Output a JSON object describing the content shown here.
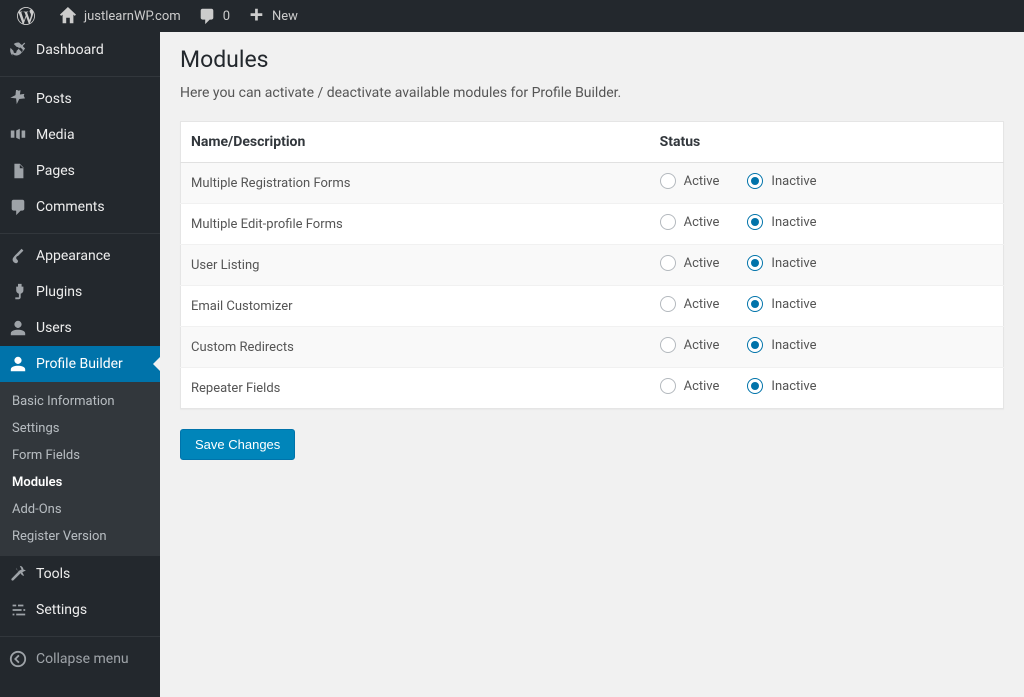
{
  "toolbar": {
    "site_name": "justlearnWP.com",
    "comments_count": "0",
    "new_label": "New"
  },
  "sidebar": {
    "items": [
      {
        "label": "Dashboard",
        "icon": "dashboard"
      },
      {
        "label": "Posts",
        "icon": "pin"
      },
      {
        "label": "Media",
        "icon": "media"
      },
      {
        "label": "Pages",
        "icon": "page"
      },
      {
        "label": "Comments",
        "icon": "comment"
      },
      {
        "label": "Appearance",
        "icon": "brush"
      },
      {
        "label": "Plugins",
        "icon": "plugin"
      },
      {
        "label": "Users",
        "icon": "user"
      },
      {
        "label": "Profile Builder",
        "icon": "profile"
      },
      {
        "label": "Tools",
        "icon": "wrench"
      },
      {
        "label": "Settings",
        "icon": "settings"
      }
    ],
    "submenu": [
      {
        "label": "Basic Information"
      },
      {
        "label": "Settings"
      },
      {
        "label": "Form Fields"
      },
      {
        "label": "Modules",
        "current": true
      },
      {
        "label": "Add-Ons"
      },
      {
        "label": "Register Version"
      }
    ],
    "collapse_label": "Collapse menu"
  },
  "page": {
    "title": "Modules",
    "description": "Here you can activate / deactivate available modules for Profile Builder.",
    "table": {
      "col_name": "Name/Description",
      "col_status": "Status",
      "active_label": "Active",
      "inactive_label": "Inactive",
      "rows": [
        {
          "name": "Multiple Registration Forms",
          "status": "inactive"
        },
        {
          "name": "Multiple Edit-profile Forms",
          "status": "inactive"
        },
        {
          "name": "User Listing",
          "status": "inactive"
        },
        {
          "name": "Email Customizer",
          "status": "inactive"
        },
        {
          "name": "Custom Redirects",
          "status": "inactive"
        },
        {
          "name": "Repeater Fields",
          "status": "inactive"
        }
      ]
    },
    "save_label": "Save Changes"
  }
}
